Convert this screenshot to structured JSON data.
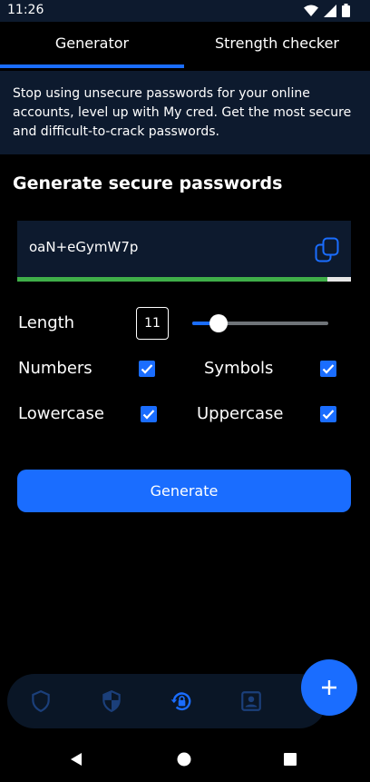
{
  "status_bar": {
    "time": "11:26",
    "icons": [
      "wifi-icon",
      "signal-icon",
      "battery-icon"
    ]
  },
  "tabs": [
    {
      "label": "Generator",
      "active": true
    },
    {
      "label": "Strength checker",
      "active": false
    }
  ],
  "banner": {
    "text": "Stop using unsecure passwords for your online accounts, level up with My cred. Get the most secure and difficult-to-crack passwords."
  },
  "section_title": "Generate secure passwords",
  "password": {
    "value": "oaN+eGymW7p",
    "strength": 0.93,
    "strength_color": "#3fae49"
  },
  "length": {
    "label": "Length",
    "value": "11",
    "slider_fraction": 0.19
  },
  "options": {
    "numbers": {
      "label": "Numbers",
      "checked": true
    },
    "symbols": {
      "label": "Symbols",
      "checked": true
    },
    "lowercase": {
      "label": "Lowercase",
      "checked": true
    },
    "uppercase": {
      "label": "Uppercase",
      "checked": true
    }
  },
  "generate_button": {
    "label": "Generate"
  },
  "bottom_nav": {
    "items": [
      "shield-outline-icon",
      "shield-half-icon",
      "lock-reset-icon",
      "account-box-icon"
    ],
    "active": "lock-reset-icon"
  },
  "fab": {
    "icon": "plus-icon"
  },
  "colors": {
    "accent": "#1a6dff",
    "panel": "#0d1a2e",
    "background": "#000000"
  }
}
